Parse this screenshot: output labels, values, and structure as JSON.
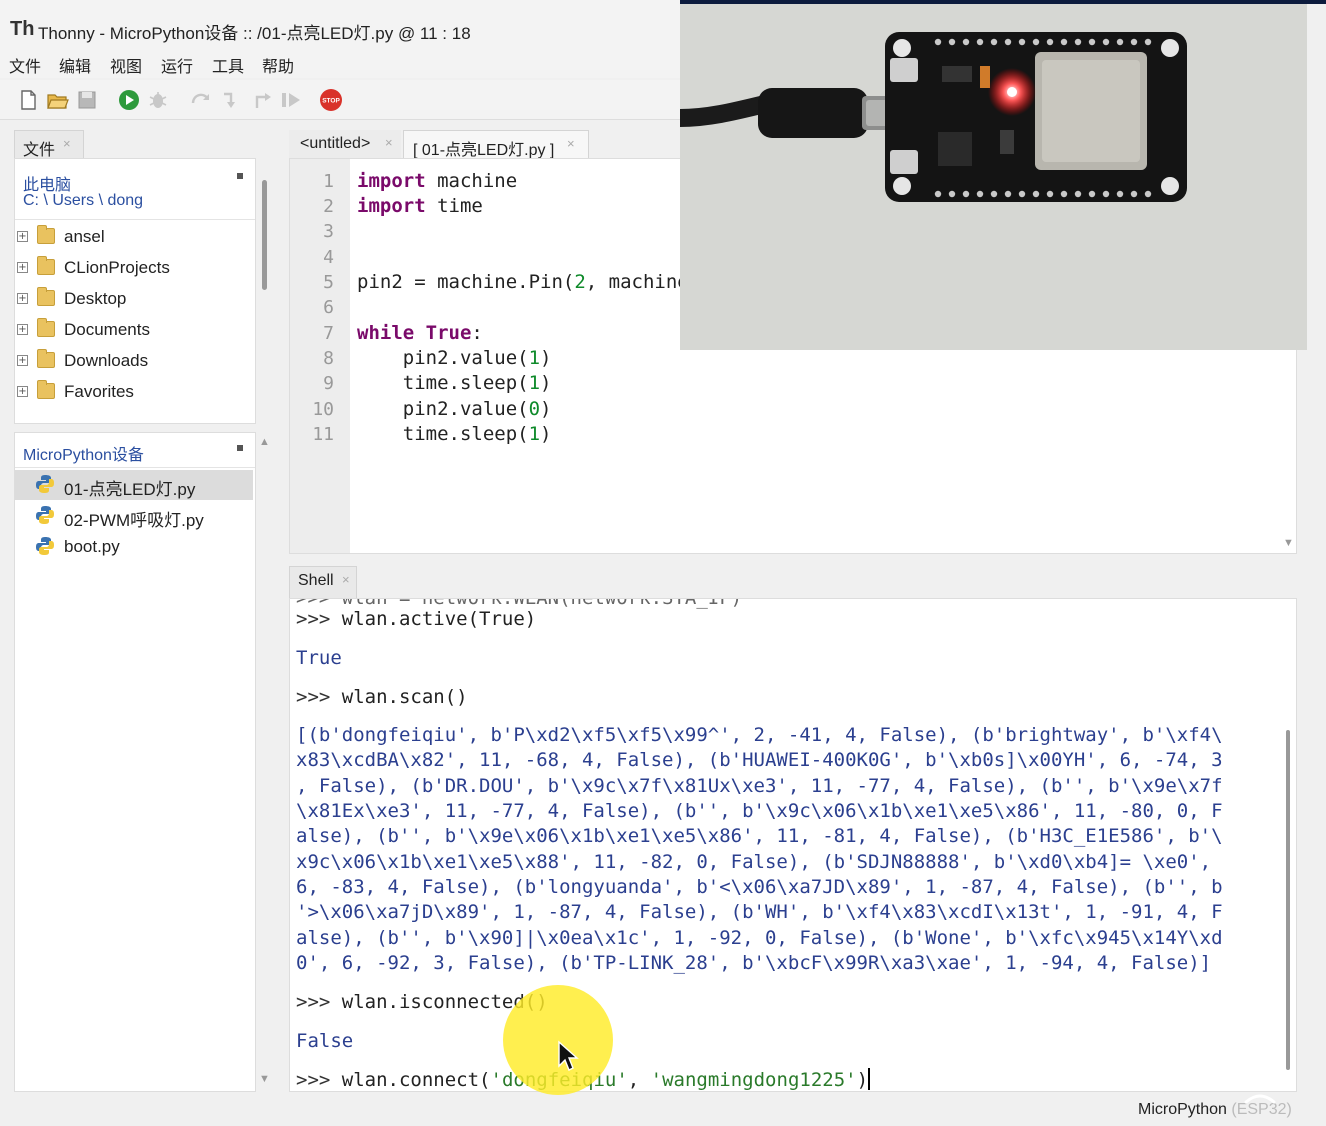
{
  "window": {
    "logo": "Th",
    "title": "Thonny  -  MicroPython设备 :: /01-点亮LED灯.py  @  11 : 18"
  },
  "menu": [
    "文件",
    "编辑",
    "视图",
    "运行",
    "工具",
    "帮助"
  ],
  "toolbar": {
    "icons": [
      "new-file-icon",
      "open-file-icon",
      "save-icon",
      "run-icon",
      "debug-icon",
      "step-over-icon",
      "step-into-icon",
      "step-out-icon",
      "resume-icon",
      "stop-icon"
    ],
    "stop_label": "STOP"
  },
  "files_panel": {
    "tab_label": "文件",
    "this_pc": "此电脑",
    "path": "C: \\ Users \\ dong",
    "folders": [
      "ansel",
      "CLionProjects",
      "Desktop",
      "Documents",
      "Downloads",
      "Favorites"
    ]
  },
  "device_panel": {
    "title": "MicroPython设备",
    "files": [
      "01-点亮LED灯.py",
      "02-PWM呼吸灯.py",
      "boot.py"
    ],
    "selected_index": 0
  },
  "editor": {
    "tabs": [
      "<untitled>",
      "[ 01-点亮LED灯.py ]"
    ],
    "active_tab": 1,
    "line_numbers": [
      "1",
      "2",
      "3",
      "4",
      "5",
      "6",
      "7",
      "8",
      "9",
      "10",
      "11"
    ]
  },
  "shell": {
    "tab_label": "Shell",
    "cut_line": ">>> wlan = network.WLAN(network.STA_IF)",
    "prompt": ">>>",
    "cmd_active": "wlan.active(True)",
    "out_true": "True",
    "cmd_scan": "wlan.scan()",
    "scan_output": [
      "[(b'dongfeiqiu', b'P\\xd2\\xf5\\xf5\\x99^', 2, -41, 4, False), (b'brightway', b'\\xf4\\",
      "x83\\xcdBA\\x82', 11, -68, 4, False), (b'HUAWEI-400K0G', b'\\xb0s]\\x00YH', 6, -74, 3",
      ", False), (b'DR.DOU', b'\\x9c\\x7f\\x81Ux\\xe3', 11, -77, 4, False), (b'', b'\\x9e\\x7f",
      "\\x81Ex\\xe3', 11, -77, 4, False), (b'', b'\\x9c\\x06\\x1b\\xe1\\xe5\\x86', 11, -80, 0, F",
      "alse), (b'', b'\\x9e\\x06\\x1b\\xe1\\xe5\\x86', 11, -81, 4, False), (b'H3C_E1E586', b'\\",
      "x9c\\x06\\x1b\\xe1\\xe5\\x88', 11, -82, 0, False), (b'SDJN88888', b'\\xd0\\xb4]= \\xe0',",
      "6, -83, 4, False), (b'longyuanda', b'<\\x06\\xa7JD\\x89', 1, -87, 4, False), (b'', b",
      "'>\\x06\\xa7jD\\x89', 1, -87, 4, False), (b'WH', b'\\xf4\\x83\\xcdI\\x13t', 1, -91, 4, F",
      "alse), (b'', b'\\x90]|\\x0ea\\x1c', 1, -92, 0, False), (b'Wone', b'\\xfc\\x945\\x14Y\\xd",
      "0', 6, -92, 3, False), (b'TP-LINK_28', b'\\xbcF\\x99R\\xa3\\xae', 1, -94, 4, False)]"
    ],
    "cmd_isconnected": "wlan.isconnected()",
    "out_false": "False",
    "cmd_connect_prefix": "wlan.connect(",
    "connect_ssid": "'dongfeiqiu'",
    "connect_sep": ", ",
    "connect_pwd": "'wangmingdong1225'",
    "connect_suffix": ")"
  },
  "status": {
    "interpreter": "MicroPython",
    "board": "(ESP32)"
  },
  "colors": {
    "keyword": "#7a0a6a",
    "number": "#0e8a2a",
    "string": "#2a7a2a",
    "shell_output": "#2b3f8f",
    "highlight": "#ffec28"
  }
}
